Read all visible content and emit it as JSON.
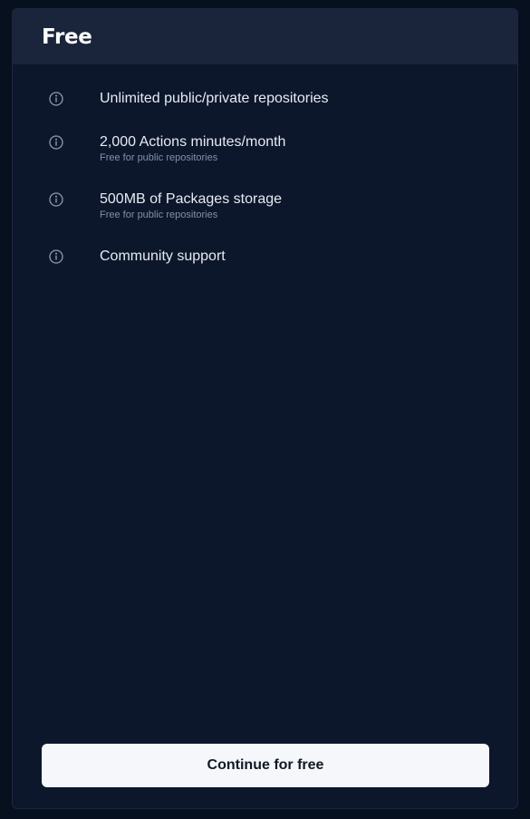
{
  "plan": {
    "title": "Free"
  },
  "features": [
    {
      "title": "Unlimited public/private repositories",
      "subtitle": "",
      "icon": "info-icon"
    },
    {
      "title": "2,000 Actions minutes/month",
      "subtitle": "Free for public repositories",
      "icon": "info-icon"
    },
    {
      "title": "500MB of Packages storage",
      "subtitle": "Free for public repositories",
      "icon": "info-icon"
    },
    {
      "title": "Community support",
      "subtitle": "",
      "icon": "info-icon"
    }
  ],
  "cta": {
    "label": "Continue for free"
  },
  "colors": {
    "page_background": "#07101f",
    "card_background": "#0c172b",
    "header_background": "#1a253b",
    "button_background": "#f5f7fa",
    "icon": "#8f9ab0"
  }
}
